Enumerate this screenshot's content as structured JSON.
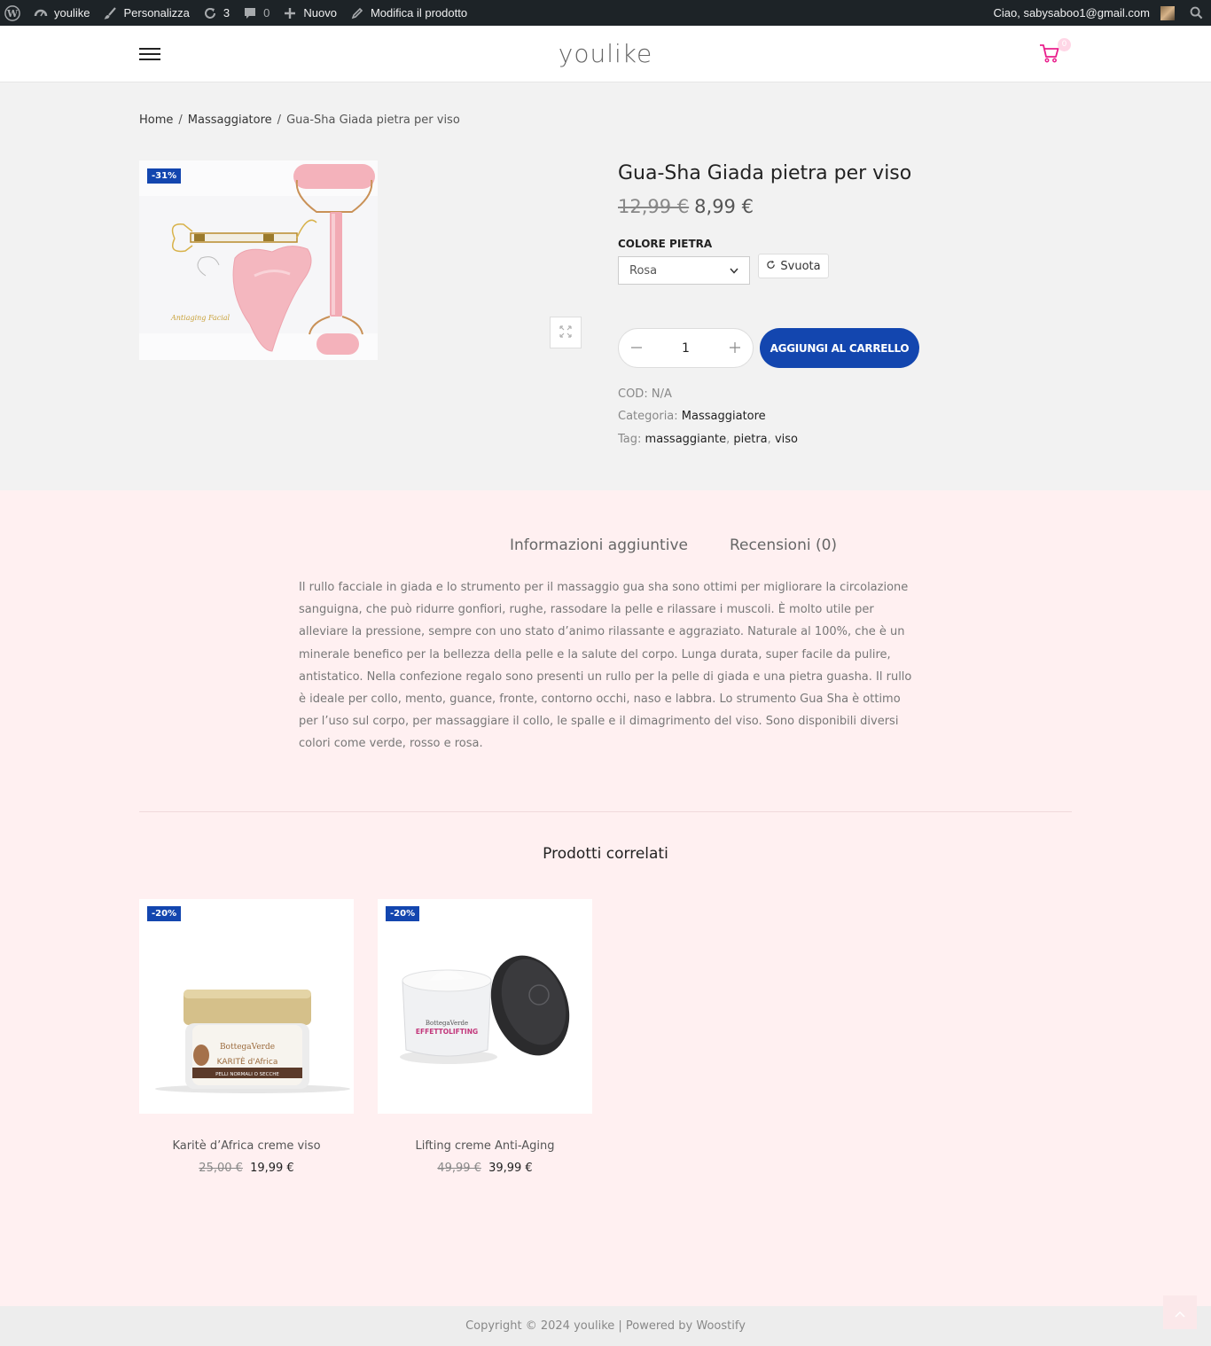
{
  "adminbar": {
    "site_name": "youlike",
    "customize": "Personalizza",
    "updates_count": "3",
    "comments_count": "0",
    "new": "Nuovo",
    "edit_product": "Modifica il prodotto",
    "greeting": "Ciao, sabysaboo1@gmail.com"
  },
  "header": {
    "logo": "youlike",
    "cart_count": "0"
  },
  "breadcrumb": {
    "home": "Home",
    "sep": "/",
    "category": "Massaggiatore",
    "current": "Gua-Sha Giada pietra per viso"
  },
  "product": {
    "badge": "-31%",
    "title": "Gua-Sha Giada pietra per viso",
    "old_price": "12,99 €",
    "price": "8,99 €",
    "attribute_label": "COLORE PIETRA",
    "attribute_value": "Rosa",
    "reset_label": "Svuota",
    "quantity": "1",
    "add_to_cart": "AGGIUNGI AL CARRELLO",
    "image_caption": "Antiaging Facial",
    "sku_label": "COD:",
    "sku": "N/A",
    "category_label": "Categoria:",
    "category": "Massaggiatore",
    "tags_label": "Tag:",
    "tags": [
      "massaggiante",
      "pietra",
      "viso"
    ],
    "tag_sep": ","
  },
  "tabs": [
    "Informazioni aggiuntive",
    "Recensioni (0)"
  ],
  "description": "Il rullo facciale in giada e lo strumento per il massaggio gua sha sono ottimi per migliorare la circolazione sanguigna, che può ridurre gonfiori, rughe, rassodare la pelle e rilassare i muscoli. È molto utile per alleviare la pressione, sempre con uno stato d’animo rilassante e aggraziato. Naturale al 100%, che è un minerale benefico per la bellezza della pelle e la salute del corpo. Lunga durata, super facile da pulire, antistatico. Nella confezione regalo sono presenti un rullo per la pelle di giada e una pietra guasha. Il rullo è ideale per collo, mento, guance, fronte, contorno occhi, naso e labbra. Lo strumento Gua Sha è ottimo per l’uso sul corpo, per massaggiare il collo, le spalle e il dimagrimento del viso. Sono disponibili diversi colori come verde, rosso e rosa.",
  "related": {
    "title": "Prodotti correlati",
    "items": [
      {
        "badge": "-20%",
        "name": "Karitè d’Africa creme viso",
        "old_price": "25,00 €",
        "price": "19,99 €",
        "label_brand": "BottegaVerde",
        "label_line": "KARITÈ d'Africa",
        "label_sub": "PELLI NORMALI O SECCHE"
      },
      {
        "badge": "-20%",
        "name": "Lifting creme Anti-Aging",
        "old_price": "49,99 €",
        "price": "39,99 €",
        "label_brand": "BottegaVerde",
        "label_line": "EFFETTOLIFTING"
      }
    ]
  },
  "footer": {
    "text": "Copyright © 2024 youlike | Powered by Woostify"
  },
  "colors": {
    "accent_blue": "#1346af",
    "cart_pink": "#e91e8c",
    "tabs_bg": "#fff0f1",
    "adminbar": "#1d2327"
  },
  "icons": [
    "wordpress-icon",
    "dashboard-icon",
    "brush-icon",
    "updates-icon",
    "comment-icon",
    "plus-icon",
    "pencil-icon",
    "search-icon",
    "menu-icon",
    "cart-icon",
    "zoom-icon",
    "reset-icon",
    "chevron-down-icon",
    "arrow-up-icon"
  ]
}
